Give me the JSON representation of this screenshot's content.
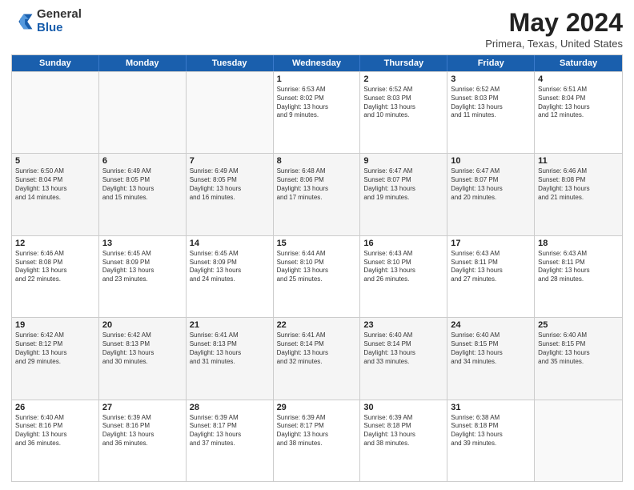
{
  "logo": {
    "general": "General",
    "blue": "Blue"
  },
  "header": {
    "month_year": "May 2024",
    "location": "Primera, Texas, United States"
  },
  "days_of_week": [
    "Sunday",
    "Monday",
    "Tuesday",
    "Wednesday",
    "Thursday",
    "Friday",
    "Saturday"
  ],
  "weeks": [
    [
      {
        "day": "",
        "info": ""
      },
      {
        "day": "",
        "info": ""
      },
      {
        "day": "",
        "info": ""
      },
      {
        "day": "1",
        "info": "Sunrise: 6:53 AM\nSunset: 8:02 PM\nDaylight: 13 hours\nand 9 minutes."
      },
      {
        "day": "2",
        "info": "Sunrise: 6:52 AM\nSunset: 8:03 PM\nDaylight: 13 hours\nand 10 minutes."
      },
      {
        "day": "3",
        "info": "Sunrise: 6:52 AM\nSunset: 8:03 PM\nDaylight: 13 hours\nand 11 minutes."
      },
      {
        "day": "4",
        "info": "Sunrise: 6:51 AM\nSunset: 8:04 PM\nDaylight: 13 hours\nand 12 minutes."
      }
    ],
    [
      {
        "day": "5",
        "info": "Sunrise: 6:50 AM\nSunset: 8:04 PM\nDaylight: 13 hours\nand 14 minutes."
      },
      {
        "day": "6",
        "info": "Sunrise: 6:49 AM\nSunset: 8:05 PM\nDaylight: 13 hours\nand 15 minutes."
      },
      {
        "day": "7",
        "info": "Sunrise: 6:49 AM\nSunset: 8:05 PM\nDaylight: 13 hours\nand 16 minutes."
      },
      {
        "day": "8",
        "info": "Sunrise: 6:48 AM\nSunset: 8:06 PM\nDaylight: 13 hours\nand 17 minutes."
      },
      {
        "day": "9",
        "info": "Sunrise: 6:47 AM\nSunset: 8:07 PM\nDaylight: 13 hours\nand 19 minutes."
      },
      {
        "day": "10",
        "info": "Sunrise: 6:47 AM\nSunset: 8:07 PM\nDaylight: 13 hours\nand 20 minutes."
      },
      {
        "day": "11",
        "info": "Sunrise: 6:46 AM\nSunset: 8:08 PM\nDaylight: 13 hours\nand 21 minutes."
      }
    ],
    [
      {
        "day": "12",
        "info": "Sunrise: 6:46 AM\nSunset: 8:08 PM\nDaylight: 13 hours\nand 22 minutes."
      },
      {
        "day": "13",
        "info": "Sunrise: 6:45 AM\nSunset: 8:09 PM\nDaylight: 13 hours\nand 23 minutes."
      },
      {
        "day": "14",
        "info": "Sunrise: 6:45 AM\nSunset: 8:09 PM\nDaylight: 13 hours\nand 24 minutes."
      },
      {
        "day": "15",
        "info": "Sunrise: 6:44 AM\nSunset: 8:10 PM\nDaylight: 13 hours\nand 25 minutes."
      },
      {
        "day": "16",
        "info": "Sunrise: 6:43 AM\nSunset: 8:10 PM\nDaylight: 13 hours\nand 26 minutes."
      },
      {
        "day": "17",
        "info": "Sunrise: 6:43 AM\nSunset: 8:11 PM\nDaylight: 13 hours\nand 27 minutes."
      },
      {
        "day": "18",
        "info": "Sunrise: 6:43 AM\nSunset: 8:11 PM\nDaylight: 13 hours\nand 28 minutes."
      }
    ],
    [
      {
        "day": "19",
        "info": "Sunrise: 6:42 AM\nSunset: 8:12 PM\nDaylight: 13 hours\nand 29 minutes."
      },
      {
        "day": "20",
        "info": "Sunrise: 6:42 AM\nSunset: 8:13 PM\nDaylight: 13 hours\nand 30 minutes."
      },
      {
        "day": "21",
        "info": "Sunrise: 6:41 AM\nSunset: 8:13 PM\nDaylight: 13 hours\nand 31 minutes."
      },
      {
        "day": "22",
        "info": "Sunrise: 6:41 AM\nSunset: 8:14 PM\nDaylight: 13 hours\nand 32 minutes."
      },
      {
        "day": "23",
        "info": "Sunrise: 6:40 AM\nSunset: 8:14 PM\nDaylight: 13 hours\nand 33 minutes."
      },
      {
        "day": "24",
        "info": "Sunrise: 6:40 AM\nSunset: 8:15 PM\nDaylight: 13 hours\nand 34 minutes."
      },
      {
        "day": "25",
        "info": "Sunrise: 6:40 AM\nSunset: 8:15 PM\nDaylight: 13 hours\nand 35 minutes."
      }
    ],
    [
      {
        "day": "26",
        "info": "Sunrise: 6:40 AM\nSunset: 8:16 PM\nDaylight: 13 hours\nand 36 minutes."
      },
      {
        "day": "27",
        "info": "Sunrise: 6:39 AM\nSunset: 8:16 PM\nDaylight: 13 hours\nand 36 minutes."
      },
      {
        "day": "28",
        "info": "Sunrise: 6:39 AM\nSunset: 8:17 PM\nDaylight: 13 hours\nand 37 minutes."
      },
      {
        "day": "29",
        "info": "Sunrise: 6:39 AM\nSunset: 8:17 PM\nDaylight: 13 hours\nand 38 minutes."
      },
      {
        "day": "30",
        "info": "Sunrise: 6:39 AM\nSunset: 8:18 PM\nDaylight: 13 hours\nand 38 minutes."
      },
      {
        "day": "31",
        "info": "Sunrise: 6:38 AM\nSunset: 8:18 PM\nDaylight: 13 hours\nand 39 minutes."
      },
      {
        "day": "",
        "info": ""
      }
    ]
  ]
}
